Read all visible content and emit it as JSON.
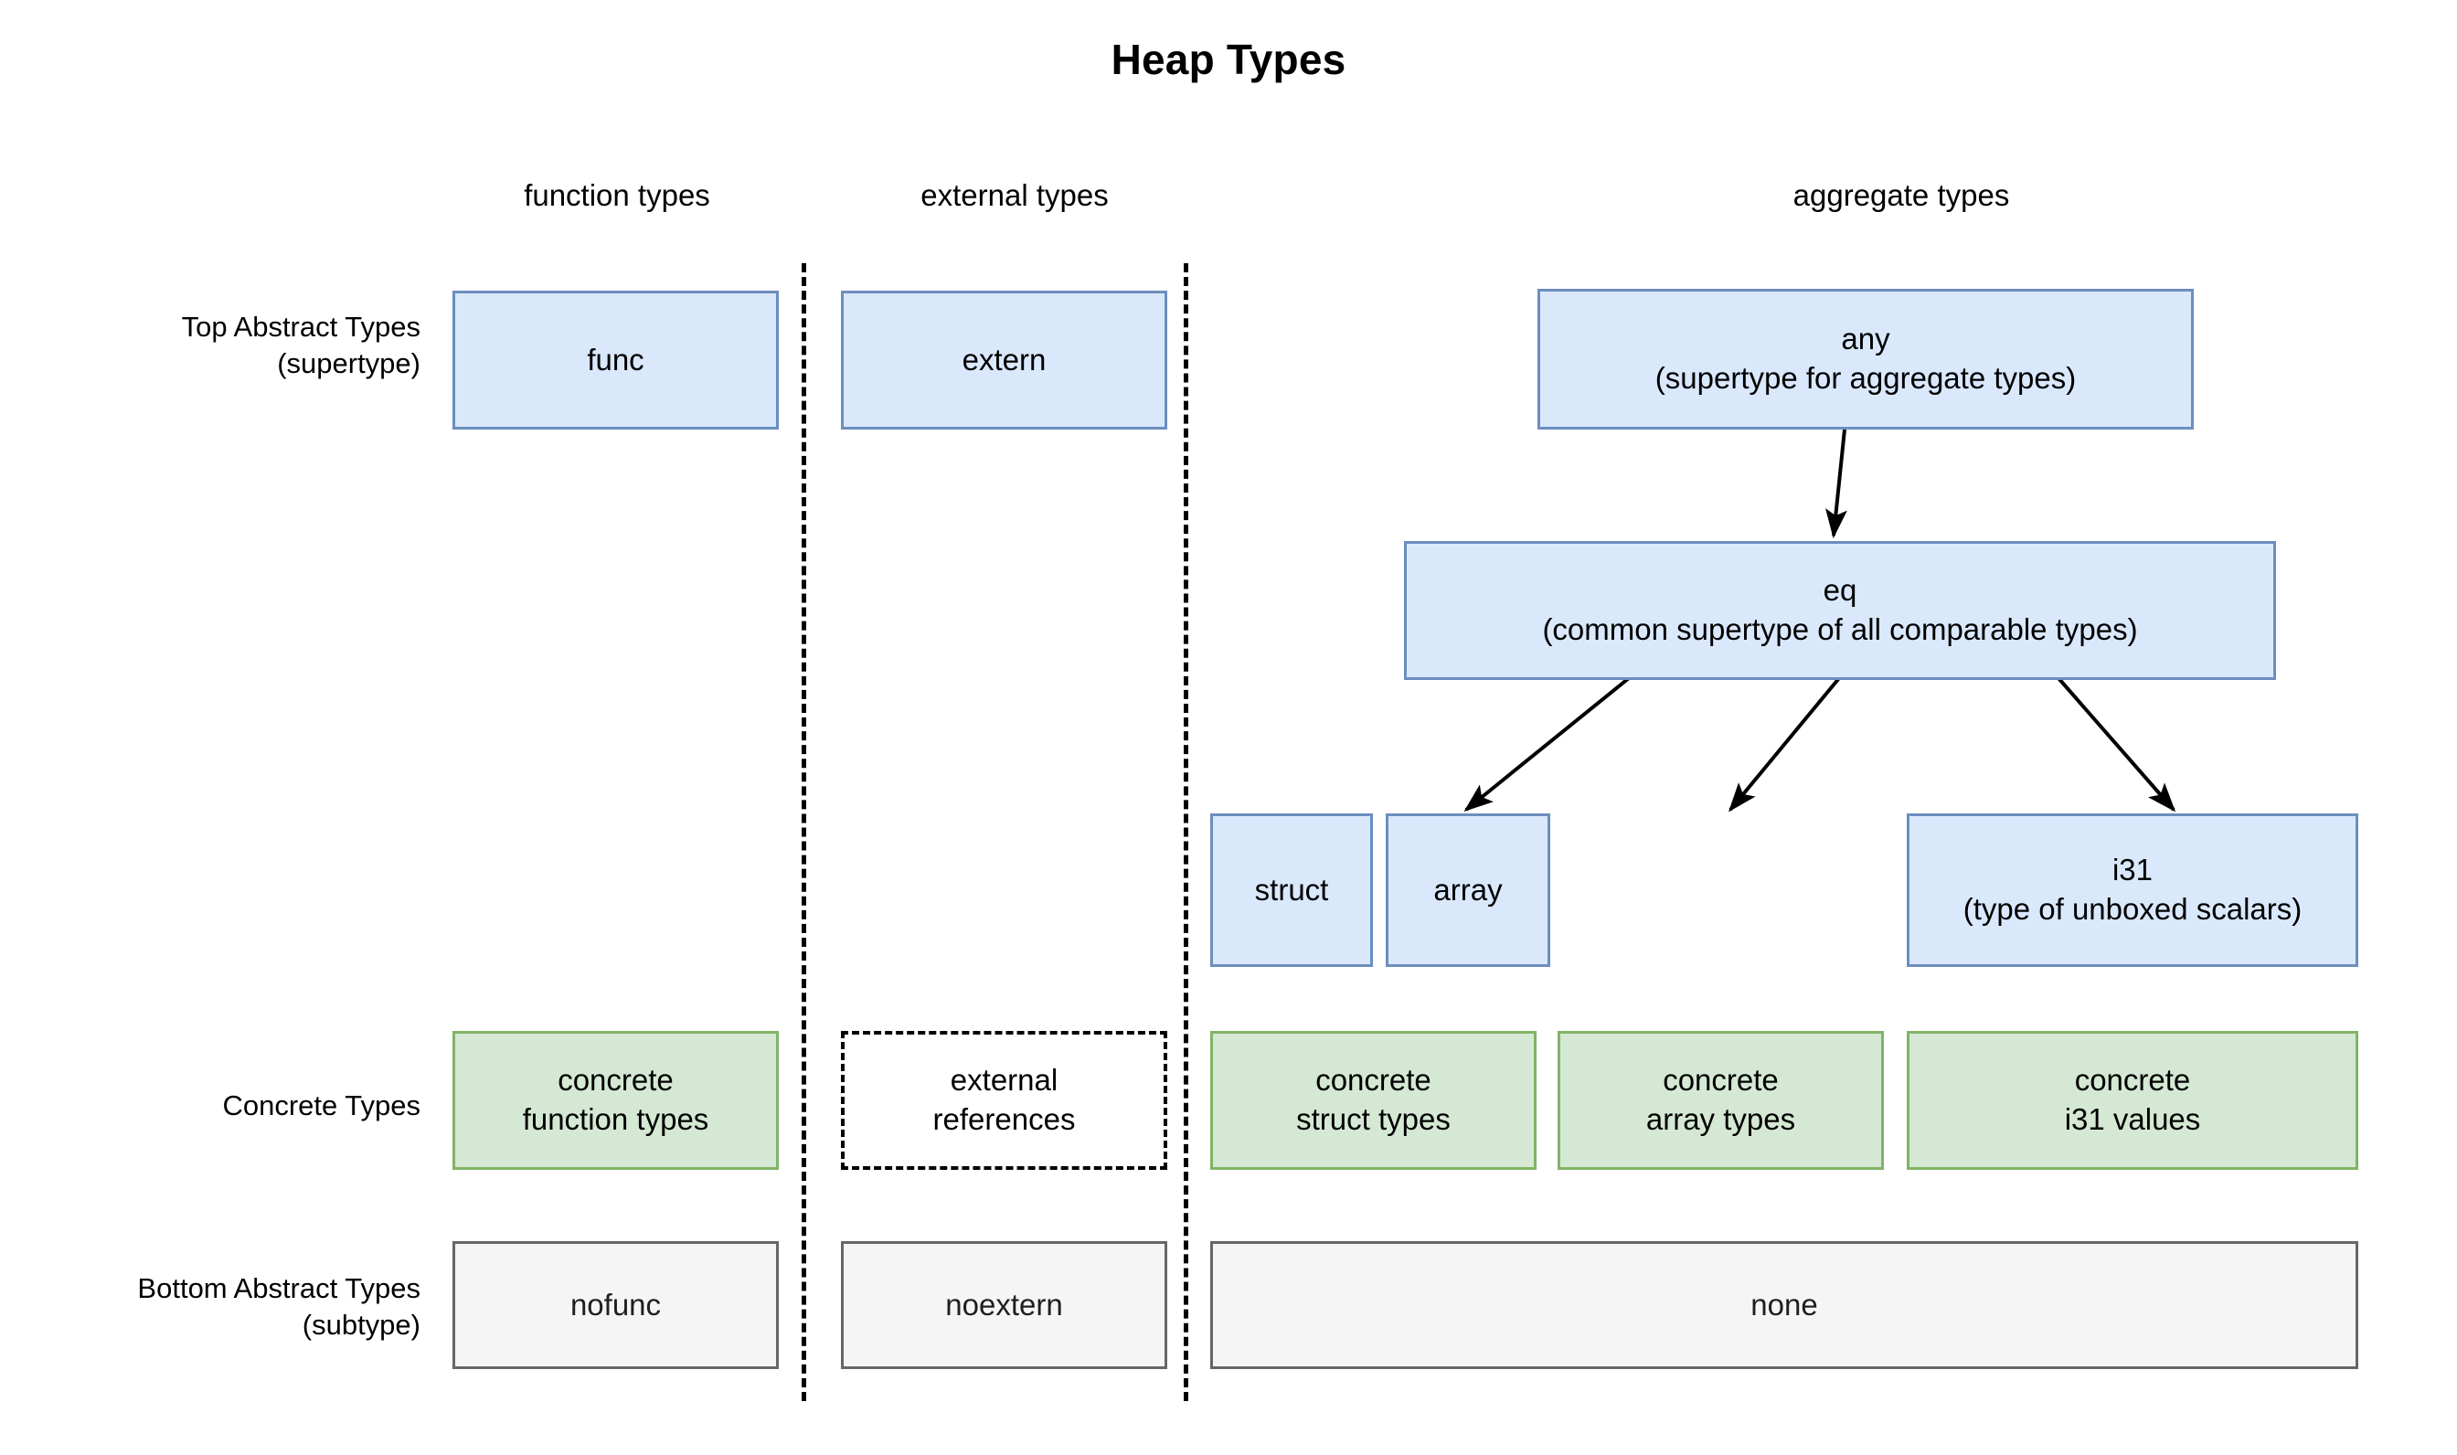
{
  "title": "Heap Types",
  "columns": [
    {
      "id": "function-types",
      "label": "function types"
    },
    {
      "id": "external-types",
      "label": "external types"
    },
    {
      "id": "aggregate-types",
      "label": "aggregate types"
    }
  ],
  "row_labels": [
    {
      "id": "top-abstract-types",
      "line1": "Top Abstract Types",
      "line2": "(supertype)"
    },
    {
      "id": "concrete-types",
      "line1": "Concrete Types",
      "line2": ""
    },
    {
      "id": "bottom-abstract-types",
      "line1": "Bottom Abstract Types",
      "line2": "(subtype)"
    }
  ],
  "nodes": {
    "func": {
      "line1": "func",
      "line2": ""
    },
    "extern": {
      "line1": "extern",
      "line2": ""
    },
    "any": {
      "line1": "any",
      "line2": "(supertype for aggregate types)"
    },
    "eq": {
      "line1": "eq",
      "line2": "(common supertype of all comparable types)"
    },
    "struct": {
      "line1": "struct",
      "line2": ""
    },
    "array": {
      "line1": "array",
      "line2": ""
    },
    "i31": {
      "line1": "i31",
      "line2": "(type of unboxed scalars)"
    },
    "concrete_function_types": {
      "line1": "concrete",
      "line2": "function types"
    },
    "external_references": {
      "line1": "external",
      "line2": "references"
    },
    "concrete_struct_types": {
      "line1": "concrete",
      "line2": "struct types"
    },
    "concrete_array_types": {
      "line1": "concrete",
      "line2": "array types"
    },
    "concrete_i31_values": {
      "line1": "concrete",
      "line2": "i31 values"
    },
    "nofunc": {
      "line1": "nofunc",
      "line2": ""
    },
    "noextern": {
      "line1": "noextern",
      "line2": ""
    },
    "none": {
      "line1": "none",
      "line2": ""
    }
  },
  "edges": [
    {
      "id": "any-to-eq",
      "from": "any",
      "to": "eq"
    },
    {
      "id": "eq-to-struct",
      "from": "eq",
      "to": "struct"
    },
    {
      "id": "eq-to-array",
      "from": "eq",
      "to": "array"
    },
    {
      "id": "eq-to-i31",
      "from": "eq",
      "to": "i31"
    }
  ],
  "colors": {
    "abstract_fill": "#dae8fc",
    "abstract_stroke": "#6c8ebf",
    "concrete_fill": "#d5e8d4",
    "concrete_stroke": "#82b366",
    "bottom_fill": "#f5f5f5",
    "bottom_stroke": "#666666",
    "dashed_stroke": "#000000",
    "edge_stroke": "#000000",
    "background": "#ffffff"
  }
}
